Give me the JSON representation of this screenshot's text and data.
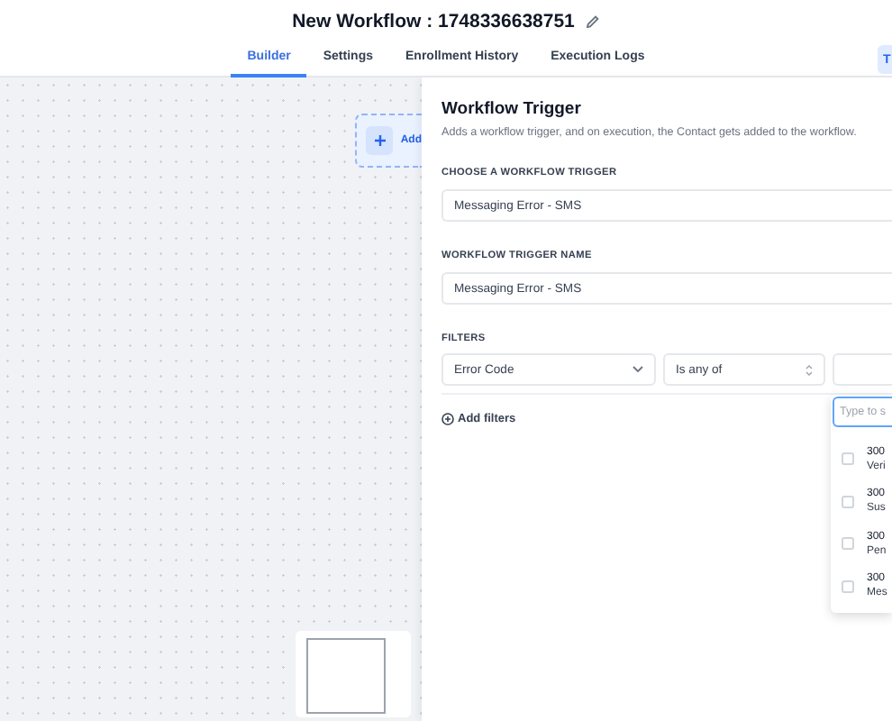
{
  "header": {
    "title": "New Workflow : 1748336638751"
  },
  "tabs": [
    {
      "label": "Builder",
      "selected": true
    },
    {
      "label": "Settings",
      "selected": false
    },
    {
      "label": "Enrollment History",
      "selected": false
    },
    {
      "label": "Execution Logs",
      "selected": false
    }
  ],
  "corner_button": {
    "label": "T"
  },
  "canvas": {
    "add_card": {
      "label": "Add"
    }
  },
  "panel": {
    "title": "Workflow Trigger",
    "description": "Adds a workflow trigger, and on execution, the Contact gets added to the workflow.",
    "trigger_label": "CHOOSE A WORKFLOW TRIGGER",
    "trigger_value": "Messaging Error - SMS",
    "name_label": "WORKFLOW TRIGGER NAME",
    "name_value": "Messaging Error - SMS",
    "filters_label": "FILTERS",
    "filter": {
      "field": "Error Code",
      "operator": "Is any of"
    },
    "add_filters": "Add filters",
    "dropdown": {
      "placeholder": "Type to s",
      "options": [
        {
          "code": "300",
          "text": "Veri",
          "checked": false
        },
        {
          "code": "300",
          "text": "Sus",
          "checked": false
        },
        {
          "code": "300",
          "text": "Pen",
          "checked": false
        },
        {
          "code": "300",
          "text": "Mes",
          "checked": false
        }
      ]
    }
  }
}
